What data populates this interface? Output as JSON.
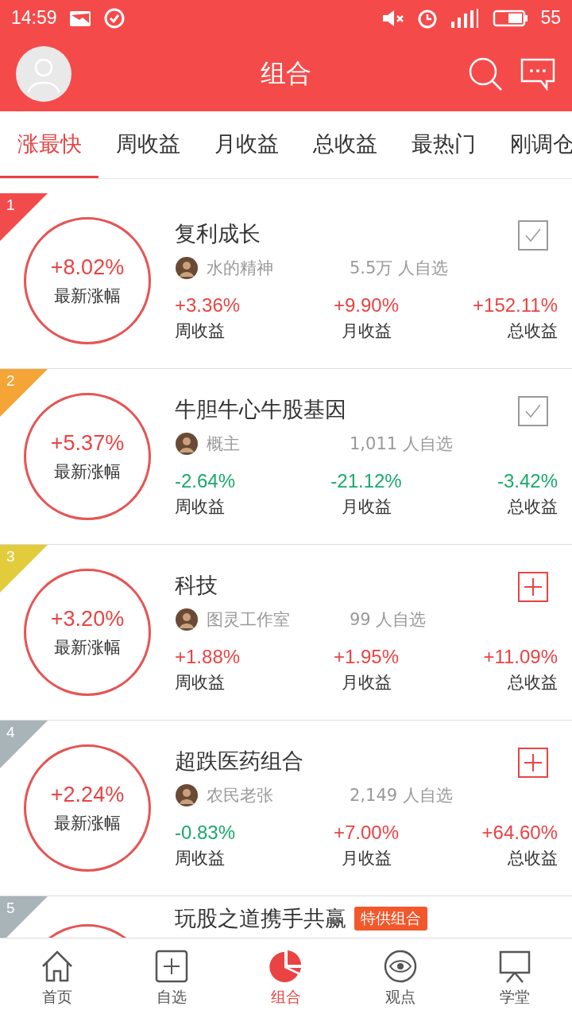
{
  "status_bar": {
    "time": "14:59",
    "battery": "55"
  },
  "header": {
    "title": "组合"
  },
  "tabs": [
    {
      "label": "涨最快",
      "selected": true
    },
    {
      "label": "周收益",
      "selected": false
    },
    {
      "label": "月收益",
      "selected": false
    },
    {
      "label": "总收益",
      "selected": false
    },
    {
      "label": "最热门",
      "selected": false
    },
    {
      "label": "刚调仓",
      "selected": false
    }
  ],
  "portfolios": [
    {
      "rank": "1",
      "color": "#f24b4b",
      "change": "+8.02%",
      "change_label": "最新涨幅",
      "name": "复利成长",
      "author": "水的精神",
      "followers": "5.5万 人自选",
      "followed": true,
      "stats": [
        {
          "value": "+3.36%",
          "label": "周收益",
          "rising": true
        },
        {
          "value": "+9.90%",
          "label": "月收益",
          "rising": true
        },
        {
          "value": "+152.11%",
          "label": "总收益",
          "rising": true
        }
      ]
    },
    {
      "rank": "2",
      "color": "#f5a535",
      "change": "+5.37%",
      "change_label": "最新涨幅",
      "name": "牛胆牛心牛股基因",
      "author": "概主",
      "followers": "1,011 人自选",
      "followed": true,
      "stats": [
        {
          "value": "-2.64%",
          "label": "周收益",
          "rising": false
        },
        {
          "value": "-21.12%",
          "label": "月收益",
          "rising": false
        },
        {
          "value": "-3.42%",
          "label": "总收益",
          "rising": false
        }
      ]
    },
    {
      "rank": "3",
      "color": "#e2cc3c",
      "change": "+3.20%",
      "change_label": "最新涨幅",
      "name": "科技",
      "author": "图灵工作室",
      "followers": "99 人自选",
      "followed": false,
      "stats": [
        {
          "value": "+1.88%",
          "label": "周收益",
          "rising": true
        },
        {
          "value": "+1.95%",
          "label": "月收益",
          "rising": true
        },
        {
          "value": "+11.09%",
          "label": "总收益",
          "rising": true
        }
      ]
    },
    {
      "rank": "4",
      "color": "#a9b4b9",
      "change": "+2.24%",
      "change_label": "最新涨幅",
      "name": "超跌医药组合",
      "author": "农民老张",
      "followers": "2,149 人自选",
      "followed": false,
      "stats": [
        {
          "value": "-0.83%",
          "label": "周收益",
          "rising": false
        },
        {
          "value": "+7.00%",
          "label": "月收益",
          "rising": true
        },
        {
          "value": "+64.60%",
          "label": "总收益",
          "rising": true
        }
      ]
    },
    {
      "rank": "5",
      "color": "#a9b4b9",
      "name": "玩股之道携手共赢",
      "badge": "特供组合"
    }
  ],
  "bottom_nav": [
    {
      "label": "首页",
      "kind": "home",
      "selected": false
    },
    {
      "label": "自选",
      "kind": "plus",
      "selected": false
    },
    {
      "label": "组合",
      "kind": "pie",
      "selected": true
    },
    {
      "label": "观点",
      "kind": "eye",
      "selected": false
    },
    {
      "label": "学堂",
      "kind": "board",
      "selected": false
    }
  ]
}
